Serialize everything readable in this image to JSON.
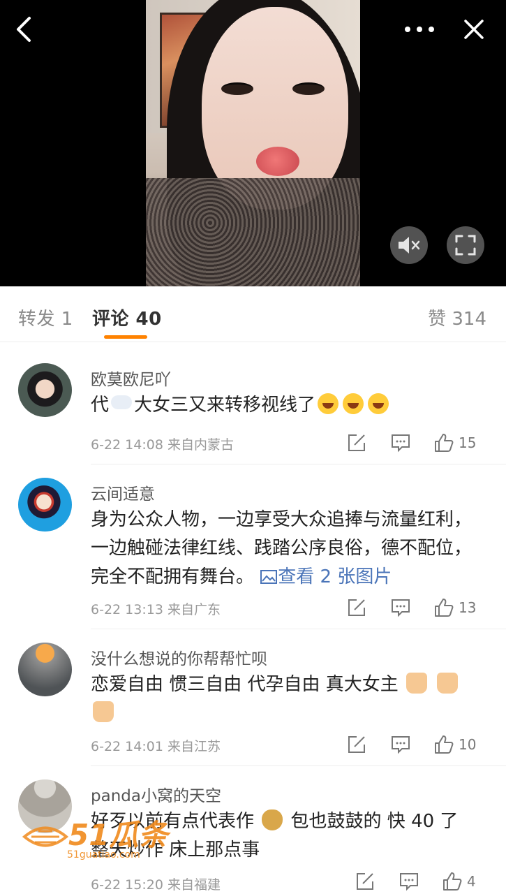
{
  "video": {
    "back_icon": "chevron-left-icon",
    "more_icon": "more-dots-icon",
    "close_icon": "close-icon",
    "mute_icon": "muted-speaker-icon",
    "fullscreen_icon": "fullscreen-icon"
  },
  "tabs": {
    "repost_label": "转发 1",
    "comment_label": "评论 40",
    "like_label": "赞 314",
    "accent_color": "#ff8200"
  },
  "comments": [
    {
      "name": "欧莫欧尼吖",
      "text_before": "代",
      "text_after": "大女三又来转移视线了",
      "time": "6-22 14:08 来自内蒙古",
      "likes": "15"
    },
    {
      "name": "云间适意",
      "text": "身为公众人物，一边享受大众追捧与流量红利，一边触碰法律红线、践踏公序良俗，德不配位，完全不配拥有舞台。",
      "image_link": "查看 2 张图片",
      "time": "6-22 13:13 来自广东",
      "likes": "13"
    },
    {
      "name": "没什么想说的你帮帮忙呗",
      "text": "恋爱自由 惯三自由 代孕自由 真大女主",
      "time": "6-22 14:01 来自江苏",
      "likes": "10"
    },
    {
      "name": "panda小窝的天空",
      "text_line1_before": "好歹以前有点代表作",
      "text_line1_after": "包也鼓鼓的 快 40 了",
      "text_line2": "整天炒作 床上那点事",
      "time": "6-22 15:20 来自福建",
      "likes": "4"
    }
  ],
  "watermark": {
    "logo_text": "51瓜条",
    "url_text": "51guatiao.com"
  }
}
